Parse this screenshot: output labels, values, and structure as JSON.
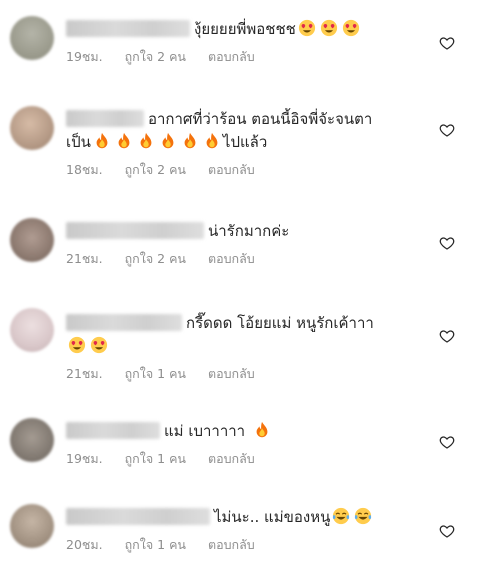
{
  "comments": [
    {
      "text": "งุ้ยยยยพี่พอชชช",
      "emoji": [
        "heart-eyes",
        "heart-eyes",
        "heart-eyes"
      ],
      "time": "19ชม.",
      "likes": "ถูกใจ 2 คน",
      "reply": "ตอบกลับ",
      "avatar_color": "#9c9c8e"
    },
    {
      "text": "อากาศที่ว่าร้อน ตอนนี้อิจพี่จัะจนตา",
      "text2": "เป็น",
      "emoji": [
        "fire",
        "fire",
        "fire",
        "fire",
        "fire",
        "fire"
      ],
      "text3": "ไปแล้ว",
      "time": "18ชม.",
      "likes": "ถูกใจ 2 คน",
      "reply": "ตอบกลับ",
      "avatar_color": "#b59a86"
    },
    {
      "text": "น่ารักมากค่ะ",
      "emoji": [],
      "time": "21ชม.",
      "likes": "ถูกใจ 2 คน",
      "reply": "ตอบกลับ",
      "avatar_color": "#8d7a70"
    },
    {
      "text": "กรี๊ดดด โอ้ยยแม่ หนูรักเค้าาา",
      "emoji": [
        "heart-eyes",
        "heart-eyes"
      ],
      "time": "21ชม.",
      "likes": "ถูกใจ 1 คน",
      "reply": "ตอบกลับ",
      "avatar_color": "#d9c7c9"
    },
    {
      "text": "แม่ เบาาาาา",
      "emoji": [
        "fire"
      ],
      "time": "19ชม.",
      "likes": "ถูกใจ 1 คน",
      "reply": "ตอบกลับ",
      "avatar_color": "#827a72"
    },
    {
      "text": "ไม่นะ.. แม่ของหนู",
      "emoji": [
        "tears-of-joy",
        "tears-of-joy"
      ],
      "time": "20ชม.",
      "likes": "ถูกใจ 1 คน",
      "reply": "ตอบกลับ",
      "avatar_color": "#a39383"
    }
  ]
}
